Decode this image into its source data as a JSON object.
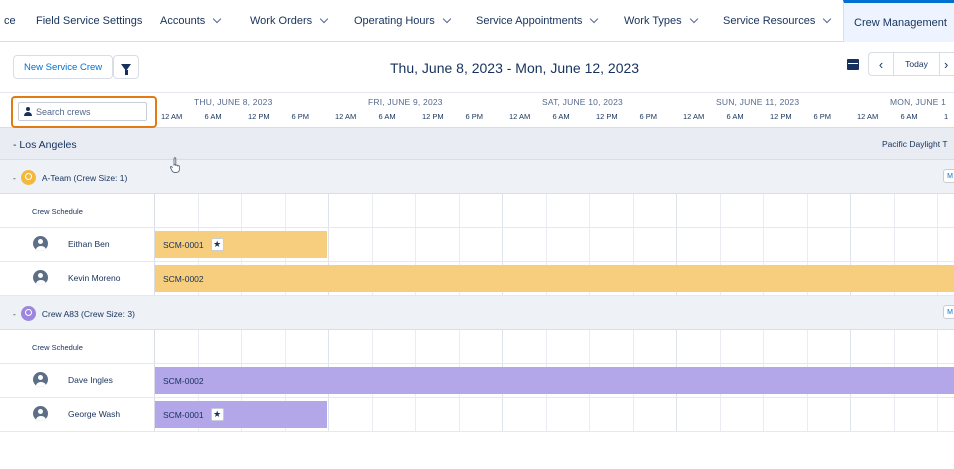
{
  "nav": {
    "tabs": [
      {
        "label": "ce",
        "dropdown": false,
        "active": false
      },
      {
        "label": "Field Service Settings",
        "dropdown": false,
        "active": false
      },
      {
        "label": "Accounts",
        "dropdown": true,
        "active": false
      },
      {
        "label": "Work Orders",
        "dropdown": true,
        "active": false
      },
      {
        "label": "Operating Hours",
        "dropdown": true,
        "active": false
      },
      {
        "label": "Service Appointments",
        "dropdown": true,
        "active": false
      },
      {
        "label": "Work Types",
        "dropdown": true,
        "active": false
      },
      {
        "label": "Service Resources",
        "dropdown": true,
        "active": false
      },
      {
        "label": "Crew Management",
        "dropdown": false,
        "active": true
      }
    ]
  },
  "toolbar": {
    "new_crew_label": "New Service Crew",
    "date_range": "Thu, June 8, 2023 - Mon, June 12, 2023",
    "prev_label": "‹",
    "today_label": "Today",
    "next_label": "›",
    "filter_icon": "funnel-icon",
    "calendar_icon": "calendar-icon"
  },
  "search": {
    "placeholder": "Search crews",
    "icon": "person-icon"
  },
  "timeline": {
    "days": [
      "THU, JUNE 8, 2023",
      "FRI, JUNE 9, 2023",
      "SAT, JUNE 10, 2023",
      "SUN, JUNE 11, 2023",
      "MON, JUNE 1"
    ],
    "hours": [
      "12 AM",
      "6 AM",
      "12 PM",
      "6 PM"
    ],
    "last_day_hours": [
      "12 AM",
      "6 AM",
      "1"
    ]
  },
  "region": {
    "name": "- Los Angeles",
    "timezone": "Pacific Daylight T"
  },
  "crews": [
    {
      "label": "A-Team (Crew Size: 1)",
      "collapse_glyph": "-",
      "color": "#f4b93b",
      "badge": "M",
      "schedule_label": "Crew Schedule",
      "members": [
        {
          "name": "Eithan Ben",
          "appointment": "SCM-0001",
          "starred": true,
          "color": "#f7cd7e",
          "days_from_window_start": 0,
          "duration_days": 1.0
        },
        {
          "name": "Kevin Moreno",
          "appointment": "SCM-0002",
          "starred": false,
          "color": "#f7cd7e",
          "days_from_window_start": 0,
          "duration_days": 5.0
        }
      ]
    },
    {
      "label": "Crew A83 (Crew Size: 3)",
      "collapse_glyph": "-",
      "color": "#9d86e0",
      "badge": "M",
      "schedule_label": "Crew Schedule",
      "members": [
        {
          "name": "Dave Ingles",
          "appointment": "SCM-0002",
          "starred": false,
          "color": "#b3a7ea",
          "days_from_window_start": 0,
          "duration_days": 5.0
        },
        {
          "name": "George Wash",
          "appointment": "SCM-0001",
          "starred": true,
          "color": "#b3a7ea",
          "days_from_window_start": 0,
          "duration_days": 1.0
        }
      ]
    }
  ],
  "colors": {
    "accent": "#0070d2",
    "search_highlight": "#e27b12"
  }
}
